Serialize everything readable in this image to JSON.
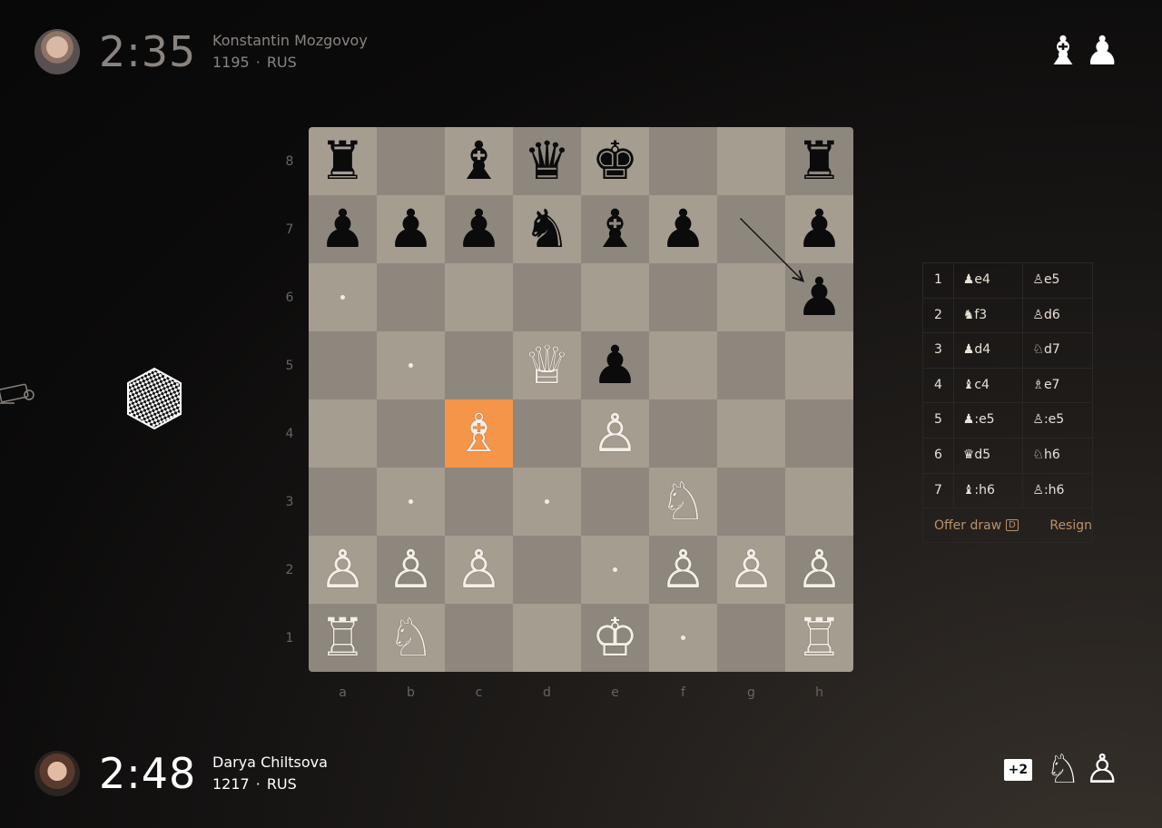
{
  "top_player": {
    "name": "Konstantin Mozgovoy",
    "clock": "2:35",
    "rating": "1195",
    "country": "RUS",
    "captured": [
      "♝",
      "♟"
    ]
  },
  "bottom_player": {
    "name": "Darya Chiltsova",
    "clock": "2:48",
    "rating": "1217",
    "country": "RUS",
    "advantage": "+2",
    "captured": [
      "♘",
      "♙"
    ]
  },
  "separator": "·",
  "board": {
    "files": [
      "a",
      "b",
      "c",
      "d",
      "e",
      "f",
      "g",
      "h"
    ],
    "ranks": [
      "8",
      "7",
      "6",
      "5",
      "4",
      "3",
      "2",
      "1"
    ],
    "highlight_square": "c4",
    "last_move_arrow": [
      "g7",
      "h6"
    ],
    "move_dots": [
      "a6",
      "b5",
      "b3",
      "d3",
      "e2",
      "f1"
    ],
    "position": {
      "a8": "♜",
      "c8": "♝",
      "d8": "♛",
      "e8": "♚",
      "h8": "♜",
      "a7": "♟",
      "b7": "♟",
      "c7": "♟",
      "d7": "♞",
      "e7": "♝",
      "f7": "♟",
      "h7": "♟",
      "h6": "♟",
      "d5": "♕",
      "e5": "♟",
      "c4": "♗",
      "e4": "♙",
      "f3": "♘",
      "a2": "♙",
      "b2": "♙",
      "c2": "♙",
      "f2": "♙",
      "g2": "♙",
      "h2": "♙",
      "a1": "♖",
      "b1": "♘",
      "e1": "♔",
      "h1": "♖"
    }
  },
  "moves": [
    {
      "n": "1",
      "white": "♟e4",
      "black": "♙e5"
    },
    {
      "n": "2",
      "white": "♞f3",
      "black": "♙d6"
    },
    {
      "n": "3",
      "white": "♟d4",
      "black": "♘d7"
    },
    {
      "n": "4",
      "white": "♝c4",
      "black": "♗e7"
    },
    {
      "n": "5",
      "white": "♟:e5",
      "black": "♙:e5"
    },
    {
      "n": "6",
      "white": "♛d5",
      "black": "♘h6"
    },
    {
      "n": "7",
      "white": "♝:h6",
      "black": "♙:h6"
    }
  ],
  "actions": {
    "offer_draw": "Offer draw",
    "offer_draw_key": "D",
    "resign": "Resign"
  },
  "colors": {
    "light_square": "#a69d91",
    "dark_square": "#8e877d",
    "highlight": "#f5954a",
    "accent_link": "#b9926a"
  }
}
